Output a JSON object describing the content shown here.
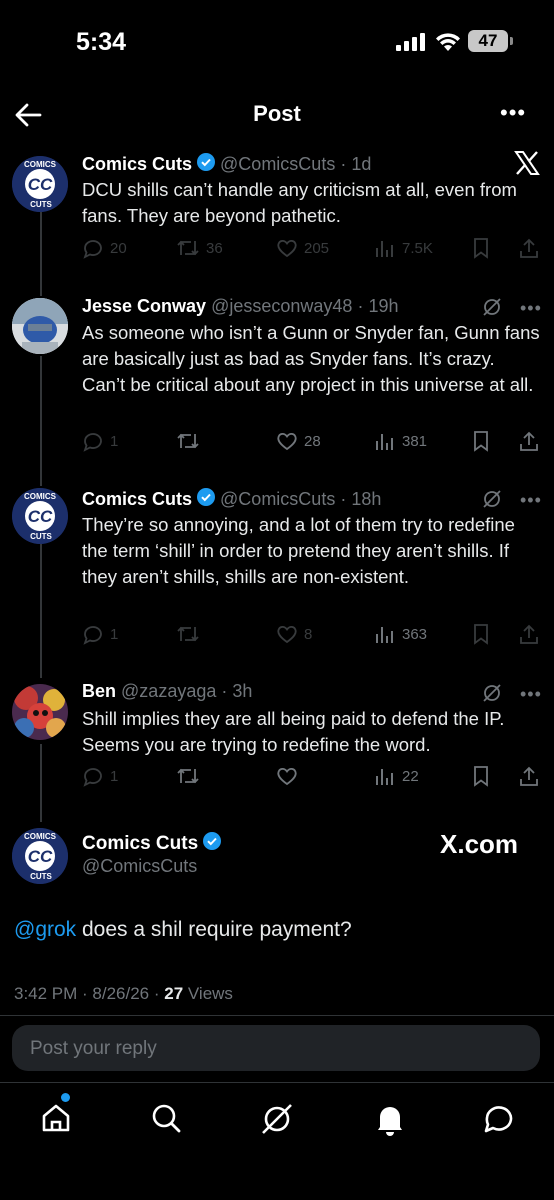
{
  "status_bar": {
    "time": "5:34",
    "battery": "47"
  },
  "header": {
    "title": "Post"
  },
  "tweets": [
    {
      "name": "Comics Cuts",
      "handle": "@ComicsCuts",
      "time": "1d",
      "text": "DCU shills can’t handle any criticism at all, even from fans. They are beyond pathetic.",
      "replies": "20",
      "retweets": "36",
      "likes": "205",
      "views": "7.5K"
    },
    {
      "name": "Jesse Conway",
      "handle": "@jesseconway48",
      "time": "19h",
      "text": "As someone who isn’t a Gunn or Snyder fan, Gunn fans are basically just as bad as Snyder fans. It’s crazy. Can’t be critical about any project in this universe at all.",
      "replies": "1",
      "retweets": "",
      "likes": "28",
      "views": "381"
    },
    {
      "name": "Comics Cuts",
      "handle": "@ComicsCuts",
      "time": "18h",
      "text": "They’re so annoying, and a lot of them try to redefine the term ‘shill’ in order to pretend they aren’t shills. If they aren’t shills, shills are non-existent.",
      "replies": "1",
      "retweets": "",
      "likes": "8",
      "views": "363"
    },
    {
      "name": "Ben",
      "handle": "@zazayaga",
      "time": "3h",
      "text": "Shill implies they are all being paid to defend the IP. Seems you are trying to redefine the word.",
      "replies": "1",
      "retweets": "",
      "likes": "",
      "views": "22"
    }
  ],
  "main_tweet": {
    "name": "Comics Cuts",
    "handle": "@ComicsCuts",
    "watermark": "X.com",
    "mention": "@grok",
    "text": " does a shil require payment?",
    "timestamp": "3:42 PM · 8/26/26 · ",
    "views_count": "27",
    "views_label": " Views"
  },
  "reply": {
    "placeholder": "Post your reply"
  },
  "avatar_logo": {
    "top": "COMICS",
    "center": "CC",
    "bottom": "CUTS"
  },
  "colors": {
    "accent": "#1d9bf0",
    "background": "#000000",
    "muted": "#71767b"
  }
}
